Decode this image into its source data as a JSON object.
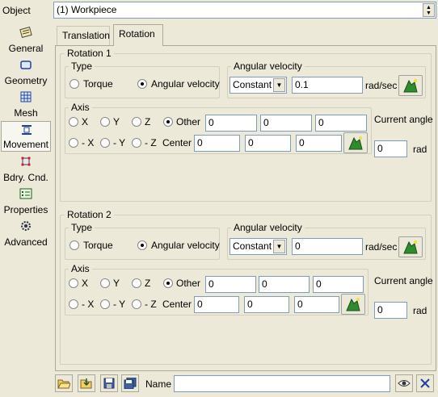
{
  "object_row": {
    "label": "Object",
    "value": "(1) Workpiece"
  },
  "sidebar": {
    "items": [
      {
        "label": "General",
        "icon": "general-icon"
      },
      {
        "label": "Geometry",
        "icon": "geometry-icon"
      },
      {
        "label": "Mesh",
        "icon": "mesh-icon"
      },
      {
        "label": "Movement",
        "icon": "movement-icon"
      },
      {
        "label": "Bdry. Cnd.",
        "icon": "boundary-condition-icon"
      },
      {
        "label": "Properties",
        "icon": "properties-icon"
      },
      {
        "label": "Advanced",
        "icon": "advanced-icon"
      }
    ]
  },
  "tabs": [
    {
      "label": "Translation"
    },
    {
      "label": "Rotation"
    }
  ],
  "rotation1": {
    "title": "Rotation 1",
    "type": {
      "title": "Type",
      "torque": "Torque",
      "angular_velocity": "Angular velocity"
    },
    "angvel": {
      "title": "Angular velocity",
      "mode": "Constant",
      "value": "0.1",
      "unit": "rad/sec"
    },
    "axis": {
      "title": "Axis",
      "x": "X",
      "y": "Y",
      "z": "Z",
      "other": "Other",
      "nx": "- X",
      "ny": "- Y",
      "nz": "- Z",
      "center": "Center",
      "other_vals": [
        "0",
        "0",
        "0"
      ],
      "center_vals": [
        "0",
        "0",
        "0"
      ]
    },
    "current_angle": {
      "label": "Current angle",
      "value": "0",
      "unit": "rad"
    }
  },
  "rotation2": {
    "title": "Rotation 2",
    "type": {
      "title": "Type",
      "torque": "Torque",
      "angular_velocity": "Angular velocity"
    },
    "angvel": {
      "title": "Angular velocity",
      "mode": "Constant",
      "value": "0",
      "unit": "rad/sec"
    },
    "axis": {
      "title": "Axis",
      "x": "X",
      "y": "Y",
      "z": "Z",
      "other": "Other",
      "nx": "- X",
      "ny": "- Y",
      "nz": "- Z",
      "center": "Center",
      "other_vals": [
        "0",
        "0",
        "0"
      ],
      "center_vals": [
        "0",
        "0",
        "0"
      ]
    },
    "current_angle": {
      "label": "Current angle",
      "value": "0",
      "unit": "rad"
    }
  },
  "bottom": {
    "name_label": "Name",
    "name_value": ""
  }
}
